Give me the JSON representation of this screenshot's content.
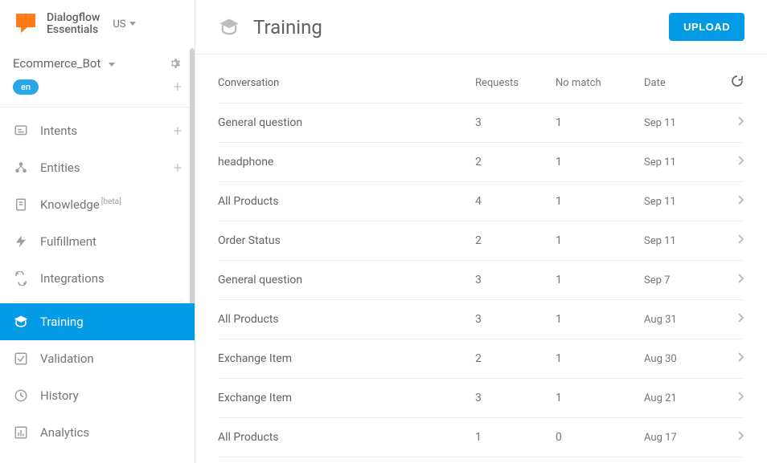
{
  "brand": {
    "line1": "Dialogflow",
    "line2": "Essentials",
    "locale": "US"
  },
  "agent": {
    "name": "Ecommerce_Bot",
    "lang": "en"
  },
  "nav": {
    "intents": "Intents",
    "entities": "Entities",
    "knowledge": "Knowledge",
    "knowledge_beta": "[beta]",
    "fulfillment": "Fulfillment",
    "integrations": "Integrations",
    "training": "Training",
    "validation": "Validation",
    "history": "History",
    "analytics": "Analytics"
  },
  "page": {
    "title": "Training",
    "upload": "UPLOAD"
  },
  "columns": {
    "conversation": "Conversation",
    "requests": "Requests",
    "nomatch": "No match",
    "date": "Date"
  },
  "rows": [
    {
      "conversation": "General question",
      "requests": "3",
      "nomatch": "1",
      "date": "Sep 11"
    },
    {
      "conversation": "headphone",
      "requests": "2",
      "nomatch": "1",
      "date": "Sep 11"
    },
    {
      "conversation": "All Products",
      "requests": "4",
      "nomatch": "1",
      "date": "Sep 11"
    },
    {
      "conversation": "Order Status",
      "requests": "2",
      "nomatch": "1",
      "date": "Sep 11"
    },
    {
      "conversation": "General question",
      "requests": "3",
      "nomatch": "1",
      "date": "Sep 7"
    },
    {
      "conversation": "All Products",
      "requests": "3",
      "nomatch": "1",
      "date": "Aug 31"
    },
    {
      "conversation": "Exchange Item",
      "requests": "2",
      "nomatch": "1",
      "date": "Aug 30"
    },
    {
      "conversation": "Exchange Item",
      "requests": "3",
      "nomatch": "1",
      "date": "Aug 21"
    },
    {
      "conversation": "All Products",
      "requests": "1",
      "nomatch": "0",
      "date": "Aug 17"
    }
  ]
}
